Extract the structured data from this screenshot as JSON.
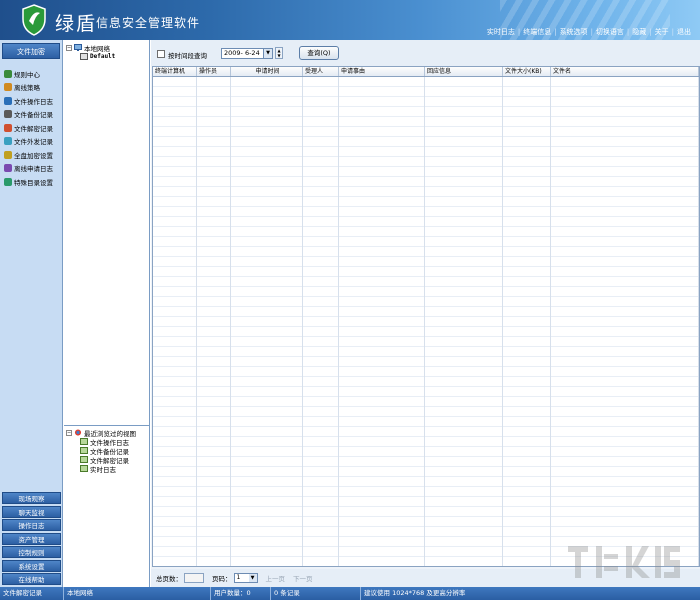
{
  "header": {
    "title_big": "绿盾",
    "title_small": "信息安全管理软件",
    "menu": [
      "实时日志",
      "终端信息",
      "系统选项",
      "切换语言",
      "隐藏",
      "关于",
      "退出"
    ]
  },
  "sidebar": {
    "head": "文件加密",
    "items": [
      {
        "label": "规则中心",
        "color": "#3a8a3a"
      },
      {
        "label": "离线策略",
        "color": "#d08a20"
      },
      {
        "label": "文件操作日志",
        "color": "#2a6fb8"
      },
      {
        "label": "文件备份记录",
        "color": "#5a5a5a"
      },
      {
        "label": "文件解密记录",
        "color": "#d05030"
      },
      {
        "label": "文件外发记录",
        "color": "#3aa0c0"
      },
      {
        "label": "全盘加密设置",
        "color": "#c0a020"
      },
      {
        "label": "离线申请日志",
        "color": "#7a4ab0"
      },
      {
        "label": "特殊目录设置",
        "color": "#2a9a6a"
      }
    ],
    "bottom": [
      "现场观察",
      "聊天监视",
      "操作日志",
      "资产管理",
      "控制规则",
      "系统设置",
      "在线帮助"
    ]
  },
  "tree": {
    "root": "本地网络",
    "child": "Default",
    "recent_root": "最近浏览过的视图",
    "recent": [
      "文件操作日志",
      "文件备份记录",
      "文件解密记录",
      "实时日志"
    ]
  },
  "toolbar": {
    "checkbox_label": "按时间段查询",
    "date": "2009- 6-24",
    "query_button": "查询(Q)"
  },
  "table": {
    "columns": [
      "终端计算机",
      "操作员",
      "申请时间",
      "受理人",
      "申请事由",
      "回应信息",
      "文件大小(KB)",
      "文件名"
    ]
  },
  "pager": {
    "total_label": "总页数：",
    "page_label": "页码：",
    "page_value": "1",
    "prev": "上一页",
    "next": "下一页"
  },
  "status": [
    "文件解密记录",
    "本地网络",
    "用户数量：0",
    "0 条记录",
    "建议使用 1024*768 及更高分辨率"
  ]
}
